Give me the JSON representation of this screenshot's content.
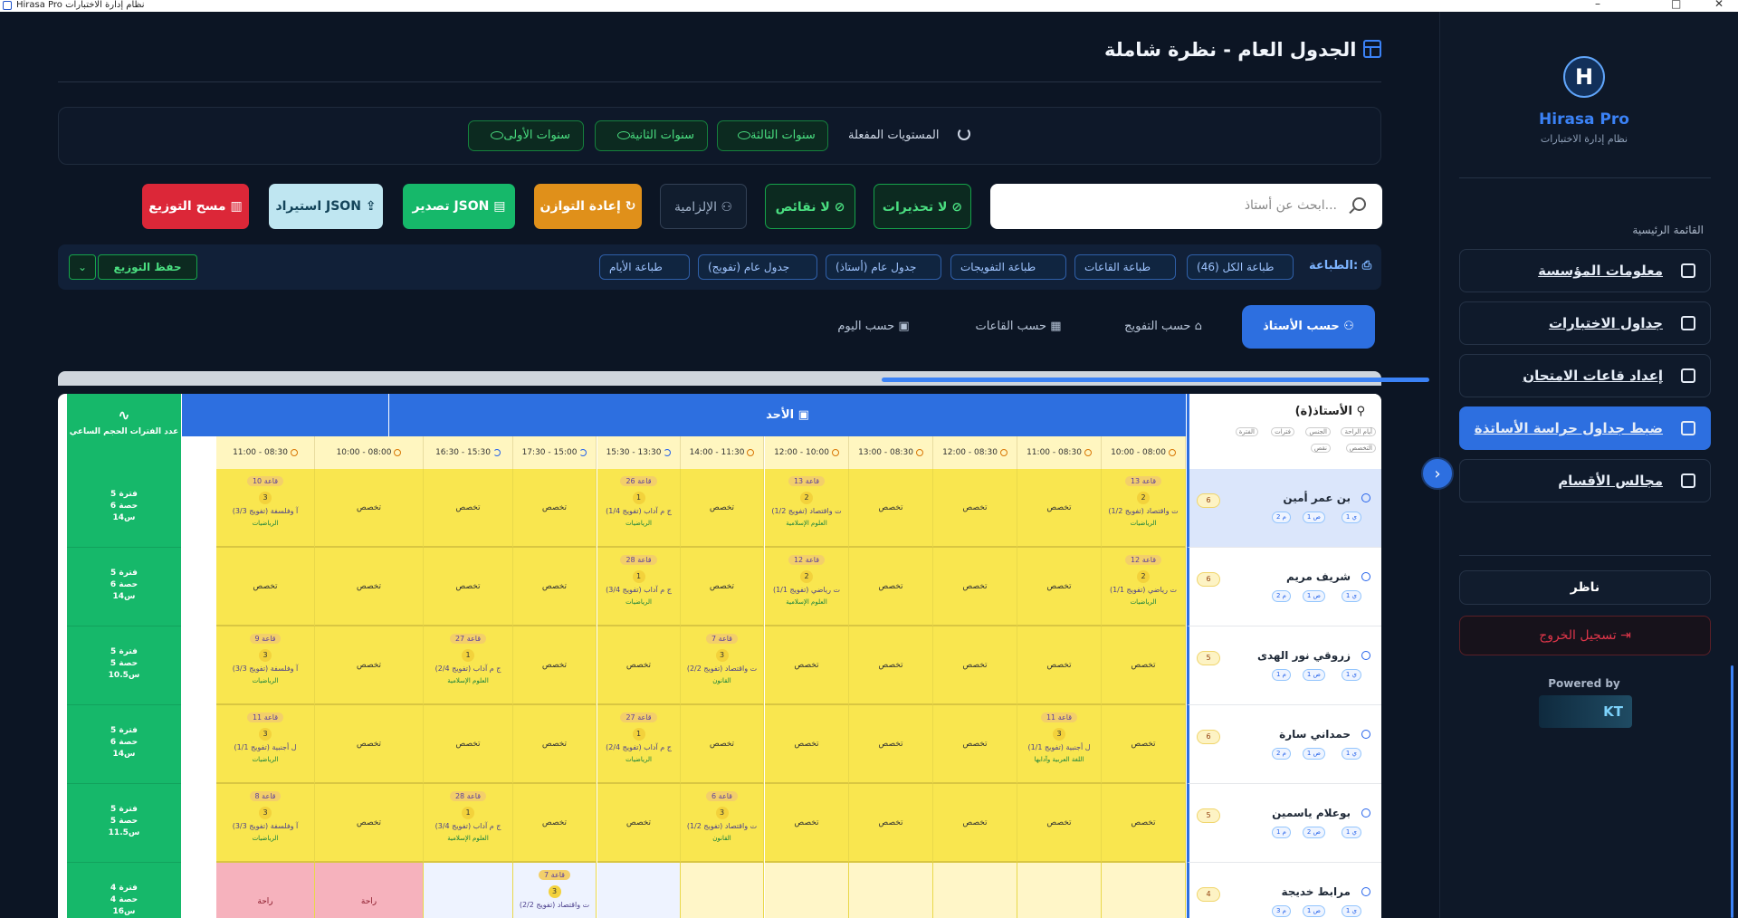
{
  "window": {
    "title": "Hirasa Pro نظام إدارة الاختبارات"
  },
  "header": {
    "title": "الجدول العام - نظرة شاملة"
  },
  "levels": {
    "label": "المستويات المفعلة",
    "chips": [
      "سنوات الثالثة",
      "سنوات الثانية",
      "سنوات الأولى"
    ]
  },
  "search": {
    "placeholder": "ابحث عن أستاذ..."
  },
  "actions": {
    "no_warnings": "لا تحذيرات",
    "no_missing": "لا نقائص",
    "obligatory": "الإلزامية",
    "rebalance": "إعادة التوازن",
    "export_json": "تصدير JSON",
    "import_json": "استيراد JSON",
    "clear": "مسح التوزيع"
  },
  "print": {
    "label": "الطباعة:",
    "buttons": [
      "طباعة الكل (46)",
      "طباعة القاعات",
      "طباعة التفويجات",
      "جدول عام (أستاذ)",
      "جدول عام (تفويج)",
      "طباعة الأيام"
    ],
    "save": "حفظ التوزيع",
    "dropdown": "⌄"
  },
  "views": [
    "حسب الأستاذ",
    "حسب التفويج",
    "حسب القاعات",
    "حسب اليوم"
  ],
  "grid": {
    "stats_header": "عدد الفترات الحجم الساعي",
    "teacher_header": "الأستاذ(ة)",
    "teacher_tags": [
      "أيام الراحة",
      "الجنس",
      "فترات",
      "الفترة",
      "التخصص",
      "نقص"
    ],
    "day": "الأحد",
    "slots": [
      "10:00 - 08:00",
      "11:00 - 08:30",
      "12:00 - 08:30",
      "13:00 - 08:30",
      "12:00 - 10:00",
      "14:00 - 11:30",
      "15:30 - 13:30",
      "17:30 - 15:00",
      "16:30 - 15:30",
      "10:00 - 08:00",
      "11:00 - 08:30"
    ],
    "rows": [
      {
        "name": "بن عمر أمين",
        "count": "6",
        "pills": [
          "1 ي",
          "1 ص",
          "2 م"
        ],
        "stat": [
          "5 فترة",
          "6 حصة",
          "14س"
        ],
        "cells": [
          {
            "room": "قاعة 13",
            "num": "2",
            "subj": "ت واقتصاد (تفويج 1/2)",
            "dept": "الرياضيات"
          },
          {
            "t": "تخصص"
          },
          {
            "t": "تخصص"
          },
          {
            "t": "تخصص"
          },
          {
            "room": "قاعة 13",
            "num": "2",
            "subj": "ت واقتصاد (تفويج 1/2)",
            "dept": "العلوم الإسلامية"
          },
          {
            "t": "تخصص"
          },
          {
            "room": "قاعة 26",
            "num": "1",
            "subj": "ج م آداب (تفويج 1/4)",
            "dept": "الرياضيات"
          },
          {
            "t": "تخصص"
          },
          {
            "t": "تخصص"
          },
          {
            "t": "تخصص"
          },
          {
            "room": "قاعة 10",
            "num": "3",
            "subj": "آ وفلسفة (تفويج 3/3)",
            "dept": "الرياضيات"
          }
        ]
      },
      {
        "name": "شريف مريم",
        "count": "6",
        "pills": [
          "1 ي",
          "1 ص",
          "2 م"
        ],
        "stat": [
          "5 فترة",
          "6 حصة",
          "14س"
        ],
        "cells": [
          {
            "room": "قاعة 12",
            "num": "2",
            "subj": "ت رياضي (تفويج 1/1)",
            "dept": "الرياضيات"
          },
          {
            "t": "تخصص"
          },
          {
            "t": "تخصص"
          },
          {
            "t": "تخصص"
          },
          {
            "room": "قاعة 12",
            "num": "2",
            "subj": "ت رياضي (تفويج 1/1)",
            "dept": "العلوم الإسلامية"
          },
          {
            "t": "تخصص"
          },
          {
            "room": "قاعة 28",
            "num": "1",
            "subj": "ج م آداب (تفويج 3/4)",
            "dept": "الرياضيات"
          },
          {
            "t": "تخصص"
          },
          {
            "t": "تخصص"
          },
          {
            "t": "تخصص"
          },
          {
            "t": "تخصص"
          }
        ]
      },
      {
        "name": "زروقي نور الهدى",
        "count": "5",
        "pills": [
          "1 ي",
          "1 ص",
          "1 م"
        ],
        "stat": [
          "5 فترة",
          "5 حصة",
          "10.5س"
        ],
        "cells": [
          {
            "t": "تخصص"
          },
          {
            "t": "تخصص"
          },
          {
            "t": "تخصص"
          },
          {
            "t": "تخصص"
          },
          {
            "t": "تخصص"
          },
          {
            "room": "قاعة 7",
            "num": "3",
            "subj": "ت واقتصاد (تفويج 2/2)",
            "dept": "القانون"
          },
          {
            "t": "تخصص"
          },
          {
            "t": "تخصص"
          },
          {
            "room": "قاعة 27",
            "num": "1",
            "subj": "ج م آداب (تفويج 2/4)",
            "dept": "العلوم الإسلامية"
          },
          {
            "t": "تخصص"
          },
          {
            "room": "قاعة 9",
            "num": "3",
            "subj": "آ وفلسفة (تفويج 3/3)",
            "dept": "الرياضيات"
          }
        ]
      },
      {
        "name": "حمداني سارة",
        "count": "6",
        "pills": [
          "1 ي",
          "1 ص",
          "2 م"
        ],
        "stat": [
          "5 فترة",
          "6 حصة",
          "14س"
        ],
        "cells": [
          {
            "t": "تخصص"
          },
          {
            "room": "قاعة 11",
            "num": "3",
            "subj": "ل أجنبية (تفويج 1/1)",
            "dept": "اللغة العربية وآدابها"
          },
          {
            "t": "تخصص"
          },
          {
            "t": "تخصص"
          },
          {
            "t": "تخصص"
          },
          {
            "t": "تخصص"
          },
          {
            "room": "قاعة 27",
            "num": "1",
            "subj": "ج م آداب (تفويج 2/4)",
            "dept": "الرياضيات"
          },
          {
            "t": "تخصص"
          },
          {
            "t": "تخصص"
          },
          {
            "t": "تخصص"
          },
          {
            "room": "قاعة 11",
            "num": "3",
            "subj": "ل أجنبية (تفويج 1/1)",
            "dept": "الرياضيات"
          }
        ]
      },
      {
        "name": "بوعلام ياسمين",
        "count": "5",
        "pills": [
          "1 ي",
          "2 ص",
          "1 م"
        ],
        "stat": [
          "5 فترة",
          "5 حصة",
          "11.5س"
        ],
        "cells": [
          {
            "t": "تخصص"
          },
          {
            "t": "تخصص"
          },
          {
            "t": "تخصص"
          },
          {
            "t": "تخصص"
          },
          {
            "t": "تخصص"
          },
          {
            "room": "قاعة 6",
            "num": "3",
            "subj": "ت واقتصاد (تفويج 1/2)",
            "dept": "القانون"
          },
          {
            "t": "تخصص"
          },
          {
            "t": "تخصص"
          },
          {
            "room": "قاعة 28",
            "num": "1",
            "subj": "ج م آداب (تفويج 3/4)",
            "dept": "العلوم الإسلامية"
          },
          {
            "t": "تخصص"
          },
          {
            "room": "قاعة 8",
            "num": "3",
            "subj": "آ وفلسفة (تفويج 3/3)",
            "dept": "الرياضيات"
          }
        ]
      },
      {
        "name": "مرابط خديجة",
        "count": "4",
        "pills": [
          "1 ي",
          "1 ص",
          "3 م"
        ],
        "stat": [
          "4 فترة",
          "4 حصة",
          "16س"
        ],
        "cells": [
          {
            "t": "",
            "pale": true
          },
          {
            "t": "",
            "pale": true
          },
          {
            "t": "",
            "pale": true
          },
          {
            "t": "",
            "pale": true
          },
          {
            "t": "",
            "pale": true
          },
          {
            "t": "",
            "pale": true
          },
          {
            "t": "",
            "blue": true
          },
          {
            "room": "قاعة 7",
            "num": "3",
            "subj": "ت واقتصاد (تفويج 2/2)",
            "dept": "",
            "blue": true
          },
          {
            "t": "",
            "blue": true
          },
          {
            "t": "راحة",
            "pink": true
          },
          {
            "t": "راحة",
            "pink": true
          }
        ]
      }
    ]
  },
  "sidebar": {
    "brand": "Hirasa Pro",
    "subtitle": "نظام إدارة الاختبارات",
    "menu_label": "القائمة الرئيسية",
    "items": [
      "معلومات المؤسسة",
      "جداول الاختبارات",
      "إعداد قاعات الامتحان",
      "ضبط جداول حراسة الأساتذة",
      "مجالس الأقسام"
    ],
    "viewer": "ناظر",
    "logout": "تسجيل الخروج",
    "powered": "Powered by",
    "kt": "KT"
  },
  "colors": {
    "accent": "#2d6fe0",
    "success": "#16b86a",
    "warning": "#e0901a",
    "danger": "#dc2738",
    "bg": "#0c1524"
  }
}
